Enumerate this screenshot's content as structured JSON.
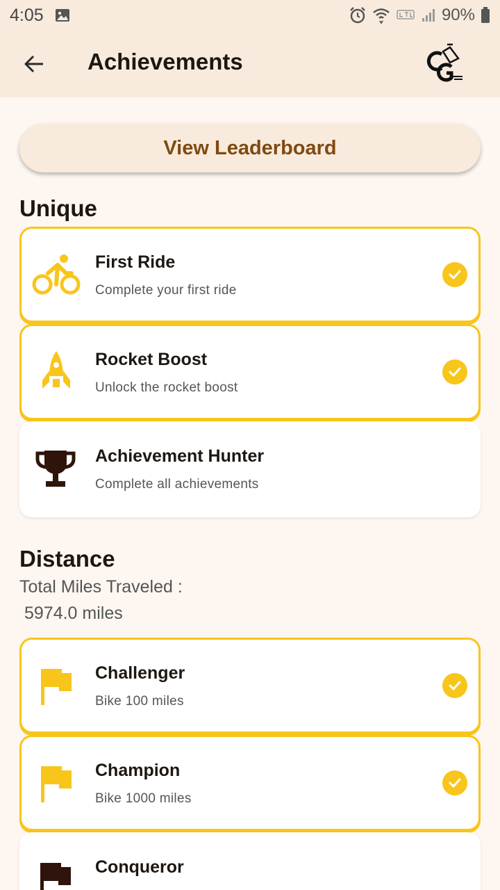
{
  "status_bar": {
    "time": "4:05",
    "battery": "90%"
  },
  "app_bar": {
    "title": "Achievements"
  },
  "leaderboard_button": {
    "label": "View Leaderboard"
  },
  "sections": {
    "unique": {
      "title": "Unique",
      "items": [
        {
          "title": "First Ride",
          "description": "Complete your first ride",
          "completed": true,
          "icon": "bike-icon"
        },
        {
          "title": "Rocket Boost",
          "description": "Unlock the rocket boost",
          "completed": true,
          "icon": "rocket-icon"
        },
        {
          "title": "Achievement Hunter",
          "description": "Complete all achievements",
          "completed": false,
          "icon": "trophy-icon"
        }
      ]
    },
    "distance": {
      "title": "Distance",
      "total_label": "Total Miles Traveled :",
      "total_value": "5974.0 miles",
      "items": [
        {
          "title": "Challenger",
          "description": "Bike 100 miles",
          "completed": true,
          "icon": "flag-icon"
        },
        {
          "title": "Champion",
          "description": "Bike 1000 miles",
          "completed": true,
          "icon": "flag-icon"
        },
        {
          "title": "Conqueror",
          "description": "",
          "completed": false,
          "icon": "flag-icon"
        }
      ]
    }
  },
  "colors": {
    "accent": "#f8c51b",
    "app_bar_bg": "#f8ebdd",
    "page_bg": "#fdf6f1",
    "button_text": "#7f4a12",
    "locked_icon": "#2e140a"
  }
}
